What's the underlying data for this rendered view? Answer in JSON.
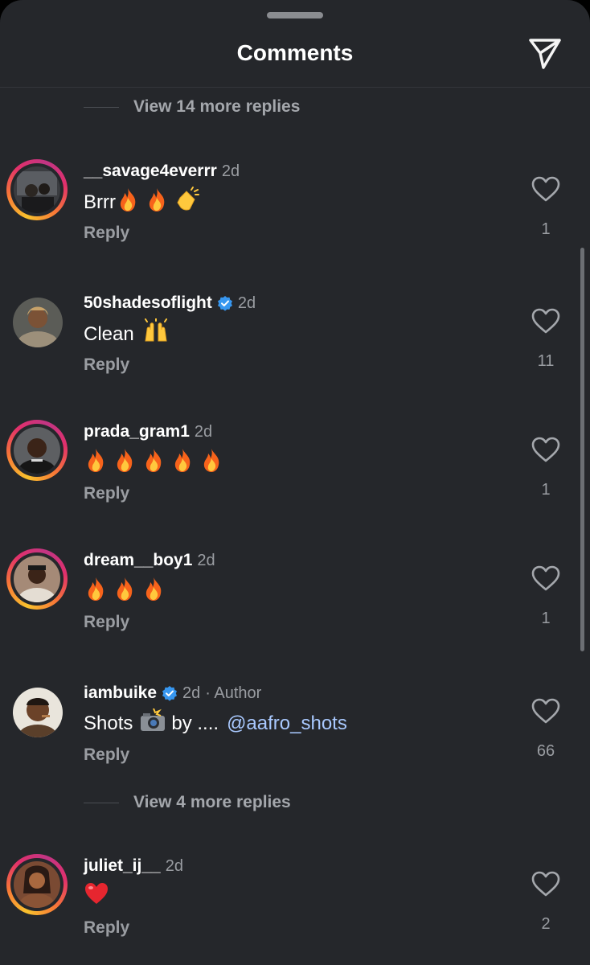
{
  "header": {
    "title": "Comments"
  },
  "view_more_top": "View 14 more replies",
  "view_more_middle": "View 4 more replies",
  "reply_label": "Reply",
  "author_suffix": "· Author",
  "comments": [
    {
      "username": "__savage4everrr",
      "time": "2d",
      "text": "Brrr",
      "emojis": [
        "fire",
        "fire",
        "clap"
      ],
      "likes": "1",
      "verified": false
    },
    {
      "username": "50shadesoflight",
      "time": "2d",
      "text": "Clean",
      "emojis": [
        "raised-hands"
      ],
      "likes": "11",
      "verified": true
    },
    {
      "username": "prada_gram1",
      "time": "2d",
      "text": "",
      "emojis": [
        "fire",
        "fire",
        "fire",
        "fire",
        "fire"
      ],
      "likes": "1",
      "verified": false
    },
    {
      "username": "dream__boy1",
      "time": "2d",
      "text": "",
      "emojis": [
        "fire",
        "fire",
        "fire"
      ],
      "likes": "1",
      "verified": false
    },
    {
      "username": "iambuike",
      "time": "2d",
      "text_before": "Shots",
      "text_after": "by ....",
      "mention": "@aafro_shots",
      "emojis": [
        "camera-flash"
      ],
      "likes": "66",
      "verified": true,
      "author": true
    },
    {
      "username": "juliet_ij__",
      "time": "2d",
      "text": "",
      "emojis": [
        "red-heart"
      ],
      "likes": "2",
      "verified": false
    }
  ],
  "colors": {
    "background": "#25272b",
    "muted_text": "#9a9da2",
    "mention": "#a9c9ff",
    "verified_badge": "#3797f0"
  }
}
